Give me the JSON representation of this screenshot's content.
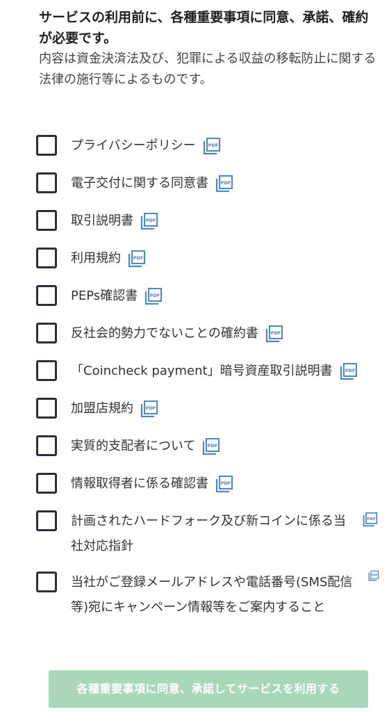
{
  "intro": {
    "title": "サービスの利用前に、各種重要事項に同意、承諾、確約が必要です。",
    "description": "内容は資金決済法及び、犯罪による収益の移転防止に関する法律の施行等によるものです。"
  },
  "consents": [
    {
      "label": "プライバシーポリシー",
      "pdf_icon": "pdf-icon"
    },
    {
      "label": "電子交付に関する同意書",
      "pdf_icon": "pdf-icon"
    },
    {
      "label": "取引説明書",
      "pdf_icon": "pdf-icon"
    },
    {
      "label": "利用規約",
      "pdf_icon": "pdf-icon"
    },
    {
      "label": "PEPs確認書",
      "pdf_icon": "pdf-icon"
    },
    {
      "label": "反社会的勢力でないことの確約書",
      "pdf_icon": "pdf-icon"
    },
    {
      "label": "「Coincheck payment」暗号資産取引説明書",
      "pdf_icon": "pdf-icon"
    },
    {
      "label": "加盟店規約",
      "pdf_icon": "pdf-icon"
    },
    {
      "label": "実質的支配者について",
      "pdf_icon": "pdf-icon"
    },
    {
      "label": "情報取得者に係る確認書",
      "pdf_icon": "pdf-icon"
    },
    {
      "label": "計画されたハードフォーク及び新コインに係る当社対応指針",
      "pdf_icon": "pdf-icon"
    },
    {
      "label": "当社がご登録メールアドレスや電話番号(SMS配信等)宛にキャンペーン情報等をご案内すること",
      "pdf_icon": "pdf-icon"
    }
  ],
  "submit": {
    "label": "各種重要事項に同意、承諾してサービスを利用する",
    "enabled": false
  },
  "colors": {
    "checkbox_border": "#2a2d3a",
    "pdf_icon": "#4a86c8",
    "submit_background": "#a9d8b8",
    "submit_text": "#ffffff"
  }
}
